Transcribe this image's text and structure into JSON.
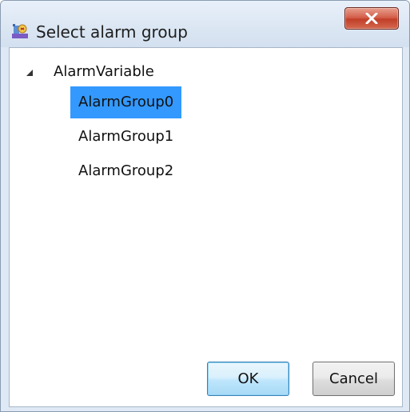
{
  "window": {
    "title": "Select alarm group",
    "title_icon": "alarm-group-app-icon",
    "close_icon": "close-icon",
    "close_button_color": "#c13f29"
  },
  "tree": {
    "root": {
      "label": "AlarmVariable",
      "expanded": true,
      "expander_icon": "expanded-triangle-icon"
    },
    "children": [
      {
        "label": "AlarmGroup0",
        "selected": true
      },
      {
        "label": "AlarmGroup1",
        "selected": false
      },
      {
        "label": "AlarmGroup2",
        "selected": false
      }
    ],
    "selection_color": "#3399ff"
  },
  "buttons": {
    "ok_label": "OK",
    "cancel_label": "Cancel"
  }
}
